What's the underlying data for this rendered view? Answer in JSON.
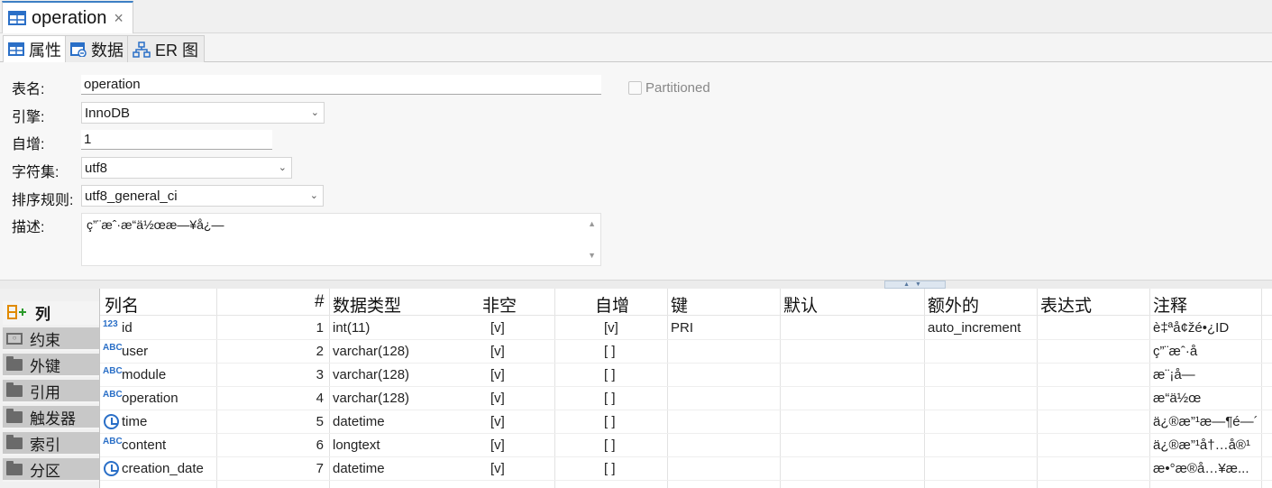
{
  "editor_tab": {
    "title": "operation",
    "close": "×"
  },
  "sub_tabs": [
    {
      "label": "属性"
    },
    {
      "label": "数据"
    },
    {
      "label": "ER 图"
    }
  ],
  "form": {
    "table_name_label": "表名:",
    "table_name_value": "operation",
    "engine_label": "引擎:",
    "engine_value": "InnoDB",
    "auto_inc_label": "自增:",
    "auto_inc_value": "1",
    "charset_label": "字符集:",
    "charset_value": "utf8",
    "collation_label": "排序规则:",
    "collation_value": "utf8_general_ci",
    "desc_label": "描述:",
    "desc_value": "ç”¨æˆ·æ“ä½œæ—¥å¿—",
    "partitioned_label": "Partitioned",
    "partitioned_checked": false
  },
  "left_nav": [
    {
      "label": "列"
    },
    {
      "label": "约束"
    },
    {
      "label": "外键"
    },
    {
      "label": "引用"
    },
    {
      "label": "触发器"
    },
    {
      "label": "索引"
    },
    {
      "label": "分区"
    }
  ],
  "grid": {
    "headers": {
      "name": "列名",
      "num": "#",
      "type": "数据类型",
      "not_null": "非空",
      "auto_inc": "自增",
      "key": "键",
      "default": "默认",
      "extra": "额外的",
      "expression": "表达式",
      "comment": "注释"
    },
    "rows": [
      {
        "icon": "123",
        "name": "id",
        "num": "1",
        "type": "int(11)",
        "not_null": "[v]",
        "auto_inc": "[v]",
        "key": "PRI",
        "default": "",
        "extra": "auto_increment",
        "expression": "",
        "comment": "è‡ªå¢žé•¿ID"
      },
      {
        "icon": "ABC",
        "name": "user",
        "num": "2",
        "type": "varchar(128)",
        "not_null": "[v]",
        "auto_inc": "[ ]",
        "key": "",
        "default": "",
        "extra": "",
        "expression": "",
        "comment": "ç”¨æˆ·å"
      },
      {
        "icon": "ABC",
        "name": "module",
        "num": "3",
        "type": "varchar(128)",
        "not_null": "[v]",
        "auto_inc": "[ ]",
        "key": "",
        "default": "",
        "extra": "",
        "expression": "",
        "comment": "æ¨¡å—"
      },
      {
        "icon": "ABC",
        "name": "operation",
        "num": "4",
        "type": "varchar(128)",
        "not_null": "[v]",
        "auto_inc": "[ ]",
        "key": "",
        "default": "",
        "extra": "",
        "expression": "",
        "comment": "æ“ä½œ"
      },
      {
        "icon": "clock",
        "name": "time",
        "num": "5",
        "type": "datetime",
        "not_null": "[v]",
        "auto_inc": "[ ]",
        "key": "",
        "default": "",
        "extra": "",
        "expression": "",
        "comment": "ä¿®æ”¹æ—¶é—´"
      },
      {
        "icon": "ABC",
        "name": "content",
        "num": "6",
        "type": "longtext",
        "not_null": "[v]",
        "auto_inc": "[ ]",
        "key": "",
        "default": "",
        "extra": "",
        "expression": "",
        "comment": "ä¿®æ”¹å†…å®¹"
      },
      {
        "icon": "clock",
        "name": "creation_date",
        "num": "7",
        "type": "datetime",
        "not_null": "[v]",
        "auto_inc": "[ ]",
        "key": "",
        "default": "",
        "extra": "",
        "expression": "",
        "comment": "æ•°æ®å…¥æ..."
      }
    ]
  },
  "colors": {
    "accent": "#3c7fc4",
    "type_icon": "#2a6fc7"
  }
}
